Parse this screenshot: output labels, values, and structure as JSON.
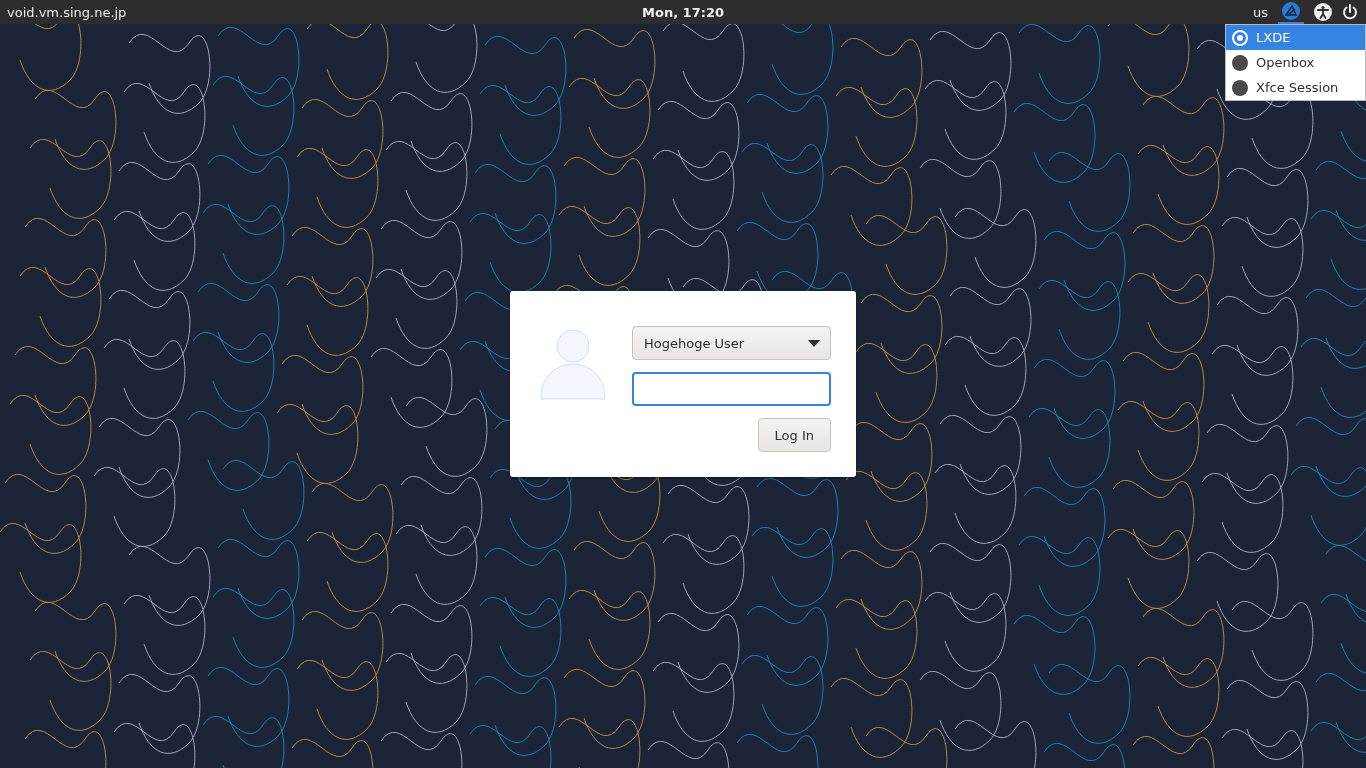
{
  "top_bar": {
    "hostname": "void.vm.sing.ne.jp",
    "clock": "Mon, 17:20",
    "keyboard_layout": "us"
  },
  "session_menu": {
    "items": [
      {
        "label": "LXDE",
        "selected": true
      },
      {
        "label": "Openbox",
        "selected": false
      },
      {
        "label": "Xfce Session",
        "selected": false
      }
    ]
  },
  "login": {
    "user": "Hogehoge User",
    "button": "Log In"
  }
}
